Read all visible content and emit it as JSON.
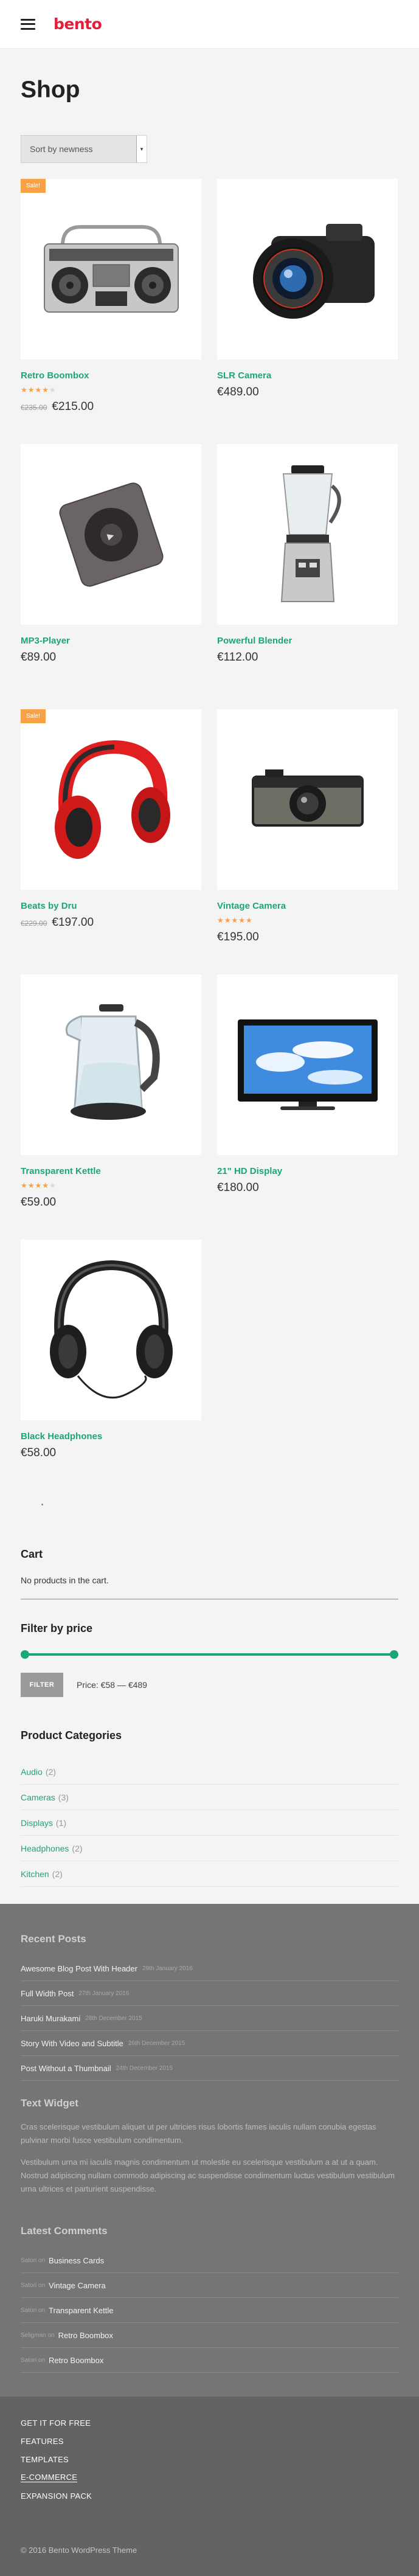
{
  "header": {
    "logo_text": "bento",
    "logo_color": "#e31d3b",
    "menu_icon": "hamburger-menu-icon"
  },
  "shop": {
    "title": "Shop",
    "sort_selected": "Sort by newness"
  },
  "colors": {
    "accent": "#1aa67a",
    "sale_badge": "#f7a246",
    "footer_bg": "#757575",
    "footer_bottom_bg": "#636363"
  },
  "products": [
    {
      "name": "Retro Boombox",
      "sale": true,
      "sale_label": "Sale!",
      "rating": 4,
      "old_price": "€235.00",
      "price": "€215.00",
      "image": "boombox"
    },
    {
      "name": "SLR Camera",
      "sale": false,
      "rating": 0,
      "old_price": "",
      "price": "€489.00",
      "image": "slr-camera"
    },
    {
      "name": "MP3-Player",
      "sale": false,
      "rating": 0,
      "old_price": "",
      "price": "€89.00",
      "image": "mp3-player"
    },
    {
      "name": "Powerful Blender",
      "sale": false,
      "rating": 0,
      "old_price": "",
      "price": "€112.00",
      "image": "blender"
    },
    {
      "name": "Beats by Dru",
      "sale": true,
      "sale_label": "Sale!",
      "rating": 0,
      "old_price": "€229.00",
      "price": "€197.00",
      "image": "red-headphones"
    },
    {
      "name": "Vintage Camera",
      "sale": false,
      "rating": 5,
      "old_price": "",
      "price": "€195.00",
      "image": "vintage-camera"
    },
    {
      "name": "Transparent Kettle",
      "sale": false,
      "rating": 4,
      "old_price": "",
      "price": "€59.00",
      "image": "kettle"
    },
    {
      "name": "21\" HD Display",
      "sale": false,
      "rating": 0,
      "old_price": "",
      "price": "€180.00",
      "image": "hd-display"
    },
    {
      "name": "Black Headphones",
      "sale": false,
      "rating": 0,
      "old_price": "",
      "price": "€58.00",
      "image": "black-headphones"
    }
  ],
  "cart": {
    "title": "Cart",
    "empty_text": "No products in the cart."
  },
  "price_filter": {
    "title": "Filter by price",
    "button_label": "FILTER",
    "range_text": "Price: €58 — €489",
    "min_fraction": 0,
    "max_fraction": 1
  },
  "categories": {
    "title": "Product Categories",
    "items": [
      {
        "label": "Audio",
        "count": "(2)"
      },
      {
        "label": "Cameras",
        "count": "(3)"
      },
      {
        "label": "Displays",
        "count": "(1)"
      },
      {
        "label": "Headphones",
        "count": "(2)"
      },
      {
        "label": "Kitchen",
        "count": "(2)"
      }
    ]
  },
  "recent_posts": {
    "title": "Recent Posts",
    "items": [
      {
        "title": "Awesome Blog Post With Header",
        "date": "29th January 2016"
      },
      {
        "title": "Full Width Post",
        "date": "27th January 2016"
      },
      {
        "title": "Haruki Murakami",
        "date": "28th December 2015"
      },
      {
        "title": "Story With Video and Subtitle",
        "date": "26th December 2015"
      },
      {
        "title": "Post Without a Thumbnail",
        "date": "24th December 2015"
      }
    ]
  },
  "text_widget": {
    "title": "Text Widget",
    "paragraph1": "Cras scelerisque vestibulum aliquet ut per ultricies risus lobortis fames iaculis nullam conubia egestas pulvinar morbi fusce vestibulum condimentum.",
    "paragraph2": "Vestibulum urna mi iaculis magnis condimentum ut molestie eu scelerisque vestibulum a at ut a quam. Nostrud adipiscing nullam commodo adipiscing ac suspendisse condimentum luctus vestibulum vestibulum urna ultrices et parturient suspendisse."
  },
  "latest_comments": {
    "title": "Latest Comments",
    "items": [
      {
        "author": "Satori on",
        "post": "Business Cards"
      },
      {
        "author": "Satori on",
        "post": "Vintage Camera"
      },
      {
        "author": "Satori on",
        "post": "Transparent Kettle"
      },
      {
        "author": "Seligman on",
        "post": "Retro Boombox"
      },
      {
        "author": "Satori on",
        "post": "Retro Boombox"
      }
    ]
  },
  "footer": {
    "menu": [
      "GET IT FOR FREE",
      "FEATURES",
      "TEMPLATES",
      "E-COMMERCE",
      "EXPANSION PACK"
    ],
    "active_item": "E-COMMERCE",
    "copyright": "© 2016 Bento WordPress Theme"
  }
}
